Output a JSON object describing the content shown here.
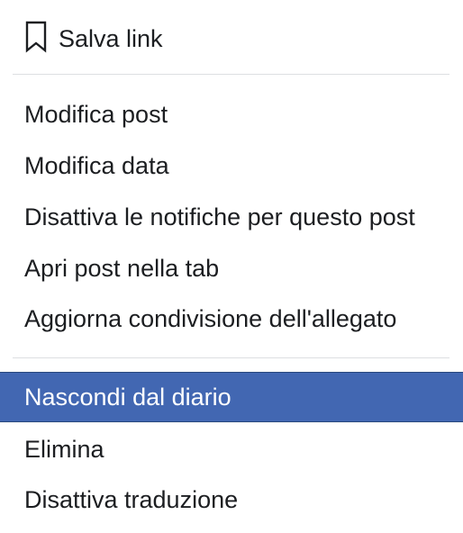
{
  "menu": {
    "save": {
      "icon": "bookmark-icon",
      "label": "Salva link"
    },
    "group1": [
      {
        "label": "Modifica post"
      },
      {
        "label": "Modifica data"
      },
      {
        "label": "Disattiva le notifiche per questo post"
      },
      {
        "label": "Apri post nella tab"
      },
      {
        "label": "Aggiorna condivisione dell'allegato"
      }
    ],
    "group2": [
      {
        "label": "Nascondi dal diario",
        "selected": true
      },
      {
        "label": "Elimina"
      },
      {
        "label": "Disattiva traduzione"
      }
    ]
  },
  "colors": {
    "highlight": "#4267b2",
    "divider": "#dddfe2",
    "text": "#1c1e21"
  }
}
